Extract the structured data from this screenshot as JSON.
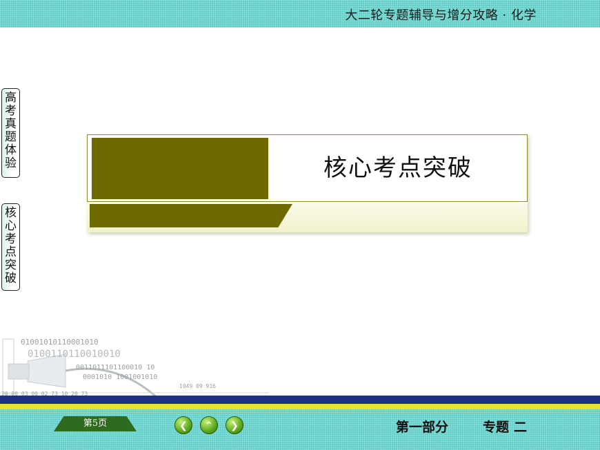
{
  "header": {
    "title": "大二轮专题辅导与增分攻略 · 化学"
  },
  "side_tabs": [
    {
      "label": "高\n考\n真\n题\n体\n验"
    },
    {
      "label": "核\n心\n考\n点\n突\n破"
    }
  ],
  "card": {
    "title": "核心考点突破"
  },
  "decor": {
    "binary_1": "01001010110001010",
    "binary_2": "0100110110010010",
    "binary_3": "0011011101100010 10",
    "binary_4": "0001010 1001001010",
    "numbers_1": "1049    09   916",
    "numbers_2": "20 00 03      00 02 73        10 20 73"
  },
  "footer": {
    "page_label": "第5页",
    "prev_icon": "chevron-left",
    "up_icon": "chevron-up",
    "next_icon": "chevron-right",
    "section": "第一部分",
    "topic": "专题",
    "topic_number": "二"
  },
  "colors": {
    "teal_bar": "#5fcfc8",
    "olive": "#6f6a00",
    "navy": "#1e2f86",
    "yellow": "#e6e23a",
    "badge_green": "#2f6b1e"
  }
}
